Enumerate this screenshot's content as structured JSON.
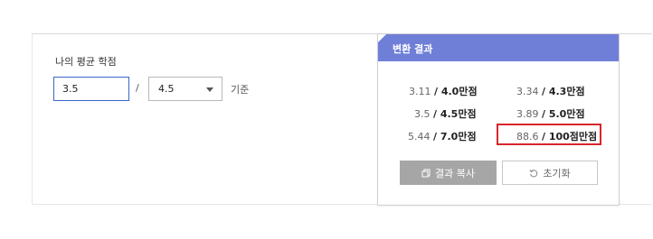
{
  "form": {
    "gpa_label": "나의 평균 학점",
    "gpa_value": "3.5",
    "separator": "/",
    "scale_selected": "4.5",
    "basis_label": "기준"
  },
  "result": {
    "title": "변환 결과",
    "items": [
      {
        "num": "3.11",
        "unit": "/ 4.0만점"
      },
      {
        "num": "3.34",
        "unit": "/ 4.3만점"
      },
      {
        "num": "3.5",
        "unit": "/ 4.5만점"
      },
      {
        "num": "3.89",
        "unit": "/ 5.0만점"
      },
      {
        "num": "5.44",
        "unit": "/ 7.0만점"
      },
      {
        "num": "88.6",
        "unit": "/ 100점만점"
      }
    ],
    "copy_label": "결과 복사",
    "reset_label": "초기화"
  },
  "colors": {
    "header": "#6f7fd8",
    "input_border": "#3a66c9",
    "highlight": "#d9262c",
    "copy_button": "#a6a6a6"
  },
  "icons": {
    "select": "chevron-down-icon",
    "copy": "copy-icon",
    "reset": "reset-icon"
  }
}
